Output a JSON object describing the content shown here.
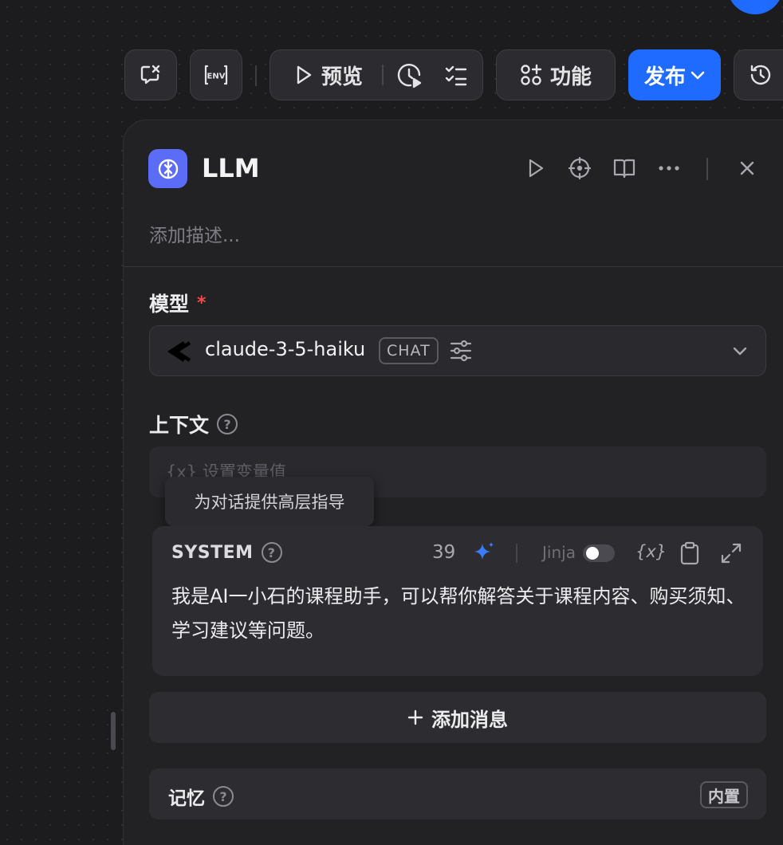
{
  "toolbar": {
    "preview_label": "预览",
    "features_label": "功能",
    "publish_label": "发布"
  },
  "node": {
    "title": "LLM",
    "description_placeholder": "添加描述..."
  },
  "model_section": {
    "label": "模型",
    "required_mark": "*",
    "model_name": "claude-3-5-haiku",
    "mode_badge": "CHAT"
  },
  "context_section": {
    "label": "上下文",
    "placeholder": "{x}  设置变量值"
  },
  "tooltip": {
    "text": "为对话提供高层指导"
  },
  "system_prompt": {
    "role_label": "SYSTEM",
    "token_count": "39",
    "jinja_label": "Jinja",
    "jinja_enabled": false,
    "variable_glyph": "{x}",
    "content": "我是AI一小石的课程助手，可以帮你解答关于课程内容、购买须知、学习建议等问题。"
  },
  "add_message": {
    "label": "添加消息"
  },
  "memory_section": {
    "label": "记忆",
    "badge": "内置"
  },
  "colors": {
    "accent": "#1f6bff",
    "node_icon": "#5b6cf6",
    "required": "#f04b4b",
    "sparkle": "#3b7cff"
  }
}
